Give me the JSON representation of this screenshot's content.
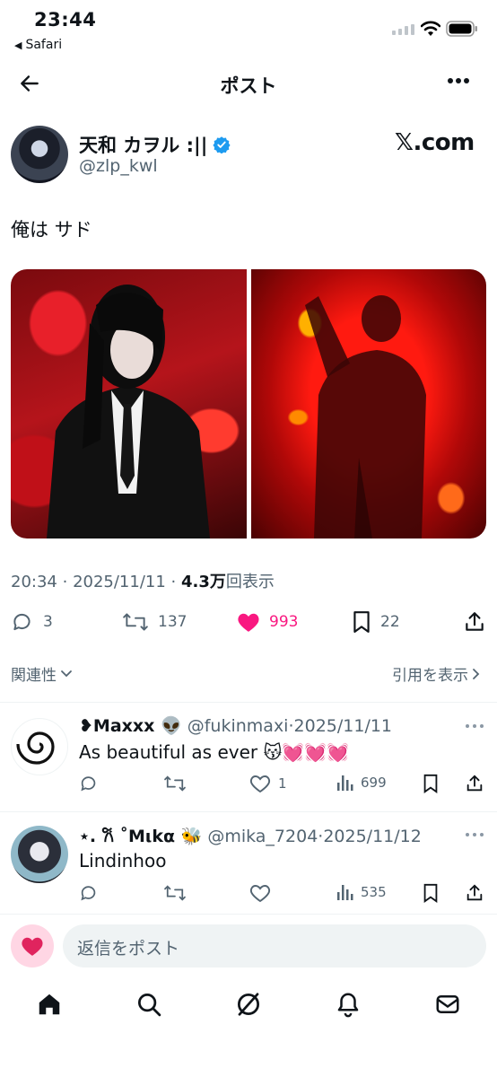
{
  "status_bar": {
    "time": "23:44",
    "back_app": "Safari"
  },
  "header": {
    "title": "ポスト"
  },
  "post": {
    "author": {
      "display_name": "天和 カヲル :||",
      "handle": "@zlp_kwl",
      "verified": true
    },
    "site_logo": "𝕏.com",
    "text": "俺は サド",
    "media_count": 2,
    "time": "20:34",
    "date": "2025/11/11",
    "views_value": "4.3万",
    "views_label": "回表示",
    "stats": {
      "replies": "3",
      "reposts": "137",
      "likes": "993",
      "bookmarks": "22"
    },
    "liked": true
  },
  "sort": {
    "label": "関連性",
    "quotes_label": "引用を表示"
  },
  "replies": [
    {
      "name": "❥Maxxx 👽",
      "handle": "@fukinmaxi",
      "date": "2025/11/11",
      "text": "As beautiful as ever 😽💓💓💓",
      "likes": "1",
      "views": "699"
    },
    {
      "name": "⋆. 𐙚 ˚Mιkα 🐝",
      "handle": "@mika_7204",
      "date": "2025/11/12",
      "text": "Lindinhoo",
      "likes": "",
      "views": "535"
    }
  ],
  "composer": {
    "emoji": "❤️",
    "placeholder": "返信をポスト"
  },
  "tabs": [
    "home-icon",
    "search-icon",
    "grok-icon",
    "notifications-icon",
    "messages-icon"
  ],
  "colors": {
    "like": "#f91880",
    "verified": "#1d9bf0",
    "muted": "#536471"
  }
}
